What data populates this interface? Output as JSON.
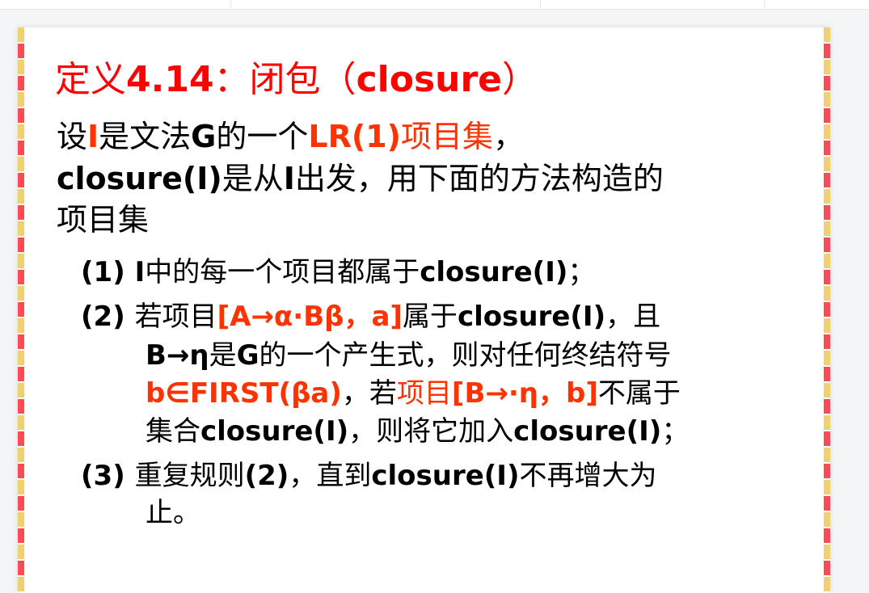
{
  "colors": {
    "title_red": "#ff0000",
    "highlight_red": "#ff3300",
    "text": "#000000"
  },
  "slide": {
    "title": [
      {
        "t": "定义",
        "c": "r"
      },
      {
        "t": "4.14",
        "c": "r",
        "b": 1
      },
      {
        "t": "：闭包（",
        "c": "r"
      },
      {
        "t": "closure",
        "c": "r",
        "b": 1
      },
      {
        "t": "）",
        "c": "r"
      }
    ],
    "intro": [
      [
        {
          "t": "设"
        },
        {
          "t": "I",
          "c": "r",
          "b": 1
        },
        {
          "t": "是文法"
        },
        {
          "t": "G",
          "b": 1
        },
        {
          "t": "的一个"
        },
        {
          "t": "LR(1)",
          "c": "r",
          "b": 1
        },
        {
          "t": "项目集",
          "c": "r"
        },
        {
          "t": "，"
        }
      ],
      [
        {
          "t": "closure(I)",
          "b": 1
        },
        {
          "t": "是从"
        },
        {
          "t": "I",
          "b": 1
        },
        {
          "t": "出发，用下面的方法构造的"
        }
      ],
      [
        {
          "t": "项目集"
        }
      ]
    ],
    "items": [
      [
        {
          "t": "(1) ",
          "b": 1
        },
        {
          "t": "I",
          "b": 1
        },
        {
          "t": "中的每一个项目都属于"
        },
        {
          "t": "closure(I)",
          "b": 1
        },
        {
          "t": "；"
        }
      ],
      [
        {
          "t": "(2) ",
          "b": 1
        },
        {
          "t": "若项目"
        },
        {
          "t": "[A→α·Bβ，a]",
          "c": "r",
          "b": 1
        },
        {
          "t": "属于"
        },
        {
          "t": "closure(I)",
          "b": 1
        },
        {
          "t": "，且"
        }
      ],
      [
        {
          "t": "B→η",
          "b": 1
        },
        {
          "t": "是"
        },
        {
          "t": "G",
          "b": 1
        },
        {
          "t": "的一个产生式，则对任何终结符号"
        }
      ],
      [
        {
          "t": "b∈FIRST(βa)",
          "c": "r",
          "b": 1
        },
        {
          "t": "，若"
        },
        {
          "t": "项目",
          "c": "r"
        },
        {
          "t": "[B→·η，b]",
          "c": "r",
          "b": 1
        },
        {
          "t": "不属于"
        }
      ],
      [
        {
          "t": "集合"
        },
        {
          "t": "closure(I)",
          "b": 1
        },
        {
          "t": "，则将它加入"
        },
        {
          "t": "closure(I)",
          "b": 1
        },
        {
          "t": "；"
        }
      ],
      [
        {
          "t": "(3) ",
          "b": 1
        },
        {
          "t": "重复规则"
        },
        {
          "t": "(2)",
          "b": 1
        },
        {
          "t": "，直到"
        },
        {
          "t": "closure(I)",
          "b": 1
        },
        {
          "t": "不再增大为"
        }
      ],
      [
        {
          "t": "止。"
        }
      ]
    ]
  }
}
